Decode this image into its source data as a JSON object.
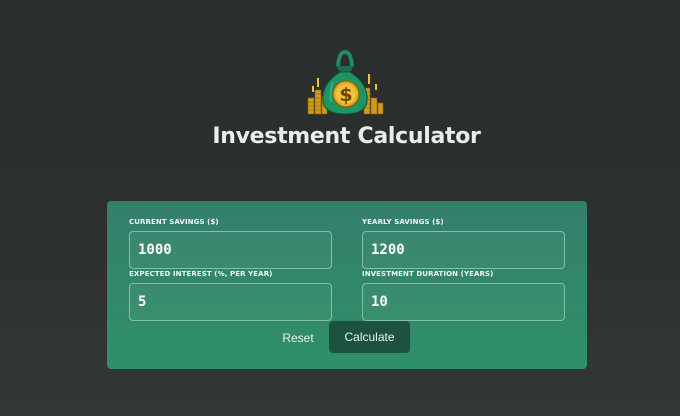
{
  "header": {
    "logo_icon": "money-bag-icon",
    "title": "Investment Calculator"
  },
  "form": {
    "fields": [
      {
        "label": "Current Savings ($)",
        "value": "1000"
      },
      {
        "label": "Yearly Savings ($)",
        "value": "1200"
      },
      {
        "label": "Expected Interest (%, per year)",
        "value": "5"
      },
      {
        "label": "Investment Duration (years)",
        "value": "10"
      }
    ],
    "reset_label": "Reset",
    "calculate_label": "Calculate"
  },
  "colors": {
    "background": "#2c302f",
    "card_top": "#347f6c",
    "card_bottom": "#2f9068",
    "calculate_button": "#1e5240",
    "title_text": "#e8eee9"
  }
}
